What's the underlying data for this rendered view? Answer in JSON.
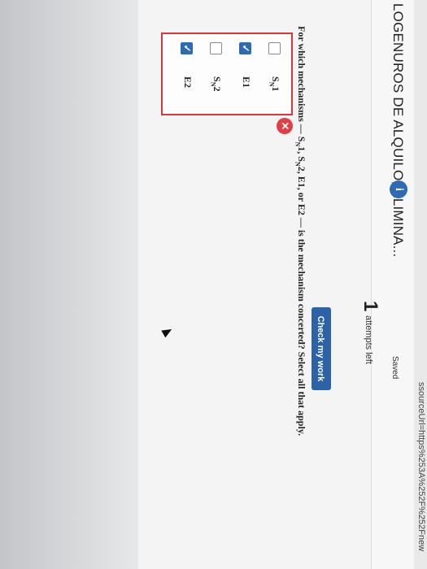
{
  "browser": {
    "url_fragment": "ssourceUrl=https%253A%252F%252Fnew"
  },
  "assignment": {
    "title": "LOGENUROS DE ALQUILO, ELIMINA...",
    "info_icon": "i",
    "saved_label": "Saved"
  },
  "toolbar": {
    "attempts_count": "1",
    "attempts_label": "attempts left",
    "check_label": "Check my work"
  },
  "question": {
    "text": "For which mechanisms — SN1, SN2, E1, or E2 — is the mechanism concerted? Select all that apply.",
    "parts": [
      "For which mechanisms — S",
      "N",
      "1, S",
      "N",
      "2, E1, or E2 — is the mechanism concerted? Select all that apply."
    ]
  },
  "options": [
    {
      "main": "S",
      "sub": "N",
      "tail": "1",
      "checked": false
    },
    {
      "main": "E1",
      "sub": "",
      "tail": "",
      "checked": true
    },
    {
      "main": "S",
      "sub": "N",
      "tail": "2",
      "checked": false
    },
    {
      "main": "E2",
      "sub": "",
      "tail": "",
      "checked": true
    }
  ],
  "feedback": {
    "status": "incorrect",
    "icon": "✕"
  },
  "colors": {
    "accent": "#2c63a8",
    "error": "#d9373a"
  }
}
